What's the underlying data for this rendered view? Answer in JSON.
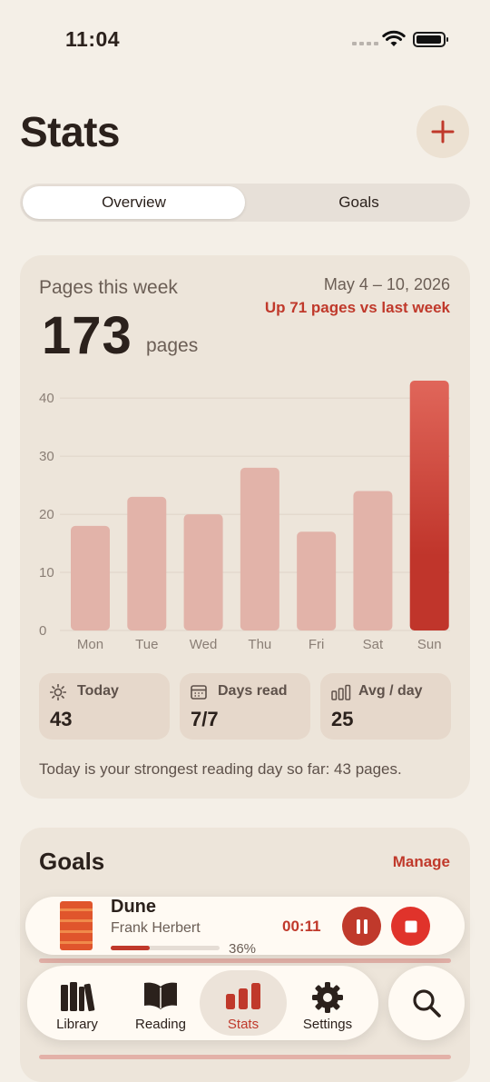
{
  "status_bar": {
    "time": "11:04"
  },
  "header": {
    "title": "Stats",
    "add_icon": "plus-icon"
  },
  "segments": [
    {
      "label": "Overview",
      "selected": true
    },
    {
      "label": "Goals",
      "selected": false
    }
  ],
  "week_card": {
    "label": "Pages this week",
    "date_range": "May 4 – 10, 2026",
    "delta": "Up 71 pages vs last week",
    "total": "173",
    "unit": "pages",
    "tiles": [
      {
        "icon": "sun-icon",
        "label": "Today",
        "value": "43"
      },
      {
        "icon": "calendar-icon",
        "label": "Days read",
        "value": "7/7"
      },
      {
        "icon": "bar-chart-icon",
        "label": "Avg / day",
        "value": "25"
      }
    ],
    "insight": "Today is your strongest reading day so far: 43 pages."
  },
  "chart_data": {
    "type": "bar",
    "categories": [
      "Mon",
      "Tue",
      "Wed",
      "Thu",
      "Fri",
      "Sat",
      "Sun"
    ],
    "values": [
      18,
      23,
      20,
      28,
      17,
      24,
      43
    ],
    "highlight_category": "Sun",
    "y_ticks": [
      0,
      10,
      20,
      30,
      40
    ],
    "ylim": [
      0,
      43
    ],
    "grid": true,
    "colors": {
      "bar": "#e2b3a9",
      "highlight_top": "#e0665a",
      "highlight_bottom": "#c0352b"
    }
  },
  "goals_card": {
    "title": "Goals",
    "manage_label": "Manage"
  },
  "now_playing": {
    "title": "Dune",
    "author": "Frank Herbert",
    "progress": 0.36,
    "progress_label": "36%",
    "elapsed": "00:11",
    "pause_icon": "pause-icon",
    "stop_icon": "stop-icon"
  },
  "tab_bar": {
    "tabs": [
      {
        "label": "Library",
        "icon": "books-icon",
        "active": false
      },
      {
        "label": "Reading",
        "icon": "open-book-icon",
        "active": false
      },
      {
        "label": "Stats",
        "icon": "bar-chart-icon",
        "active": true
      },
      {
        "label": "Settings",
        "icon": "gear-icon",
        "active": false
      }
    ],
    "search_icon": "search-icon"
  },
  "colors": {
    "accent": "#c0392b",
    "background": "#f4efe7",
    "card": "#ede5da"
  }
}
